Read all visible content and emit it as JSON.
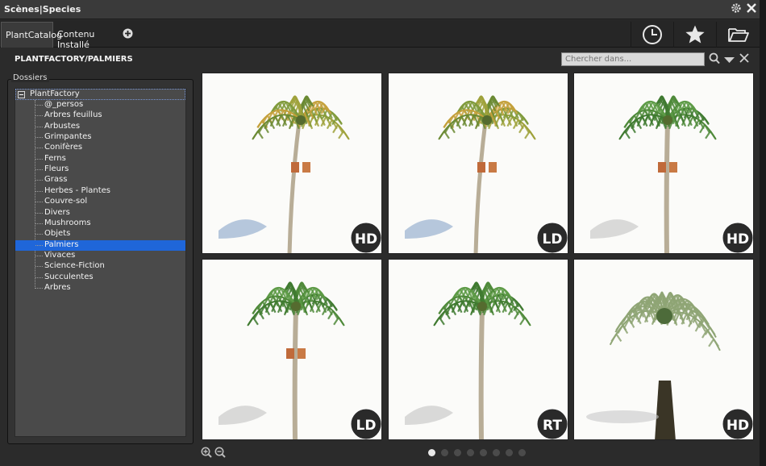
{
  "window": {
    "title": "Scènes|Species"
  },
  "tabs": [
    {
      "label": "PlantCatalog",
      "active": true
    },
    {
      "label": "Contenu Installé",
      "active": false
    }
  ],
  "toolbar_icons": [
    "add-tab-icon",
    "history-clock-icon",
    "favorites-star-icon",
    "open-folder-icon"
  ],
  "path": {
    "title": "PLANTFACTORY/PALMIERS"
  },
  "search": {
    "placeholder": "Chercher dans..."
  },
  "folders": {
    "label": "Dossiers",
    "root": "PlantFactory",
    "items": [
      "@_persos",
      "Arbres feuillus",
      "Arbustes",
      "Grimpantes",
      "Conifères",
      "Ferns",
      "Fleurs",
      "Grass",
      "Herbes - Plantes",
      "Couvre-sol",
      "Divers",
      "Mushrooms",
      "Objets",
      "Palmiers",
      "Vivaces",
      "Science-Fiction",
      "Succulentes",
      "Arbres"
    ],
    "selected": "Palmiers"
  },
  "assets": [
    {
      "badge": "HD",
      "type": "fruit-palm"
    },
    {
      "badge": "LD",
      "type": "fruit-palm"
    },
    {
      "badge": "HD",
      "type": "tall-palm"
    },
    {
      "badge": "LD",
      "type": "tall-palm"
    },
    {
      "badge": "RT",
      "type": "tall-palm-plain"
    },
    {
      "badge": "HD",
      "type": "bushy-palm"
    }
  ],
  "pagination": {
    "pages": 8,
    "current": 1
  },
  "colors": {
    "selection": "#1f66d9",
    "panel": "#2b2b2b",
    "badge": "#2a2a2a"
  }
}
